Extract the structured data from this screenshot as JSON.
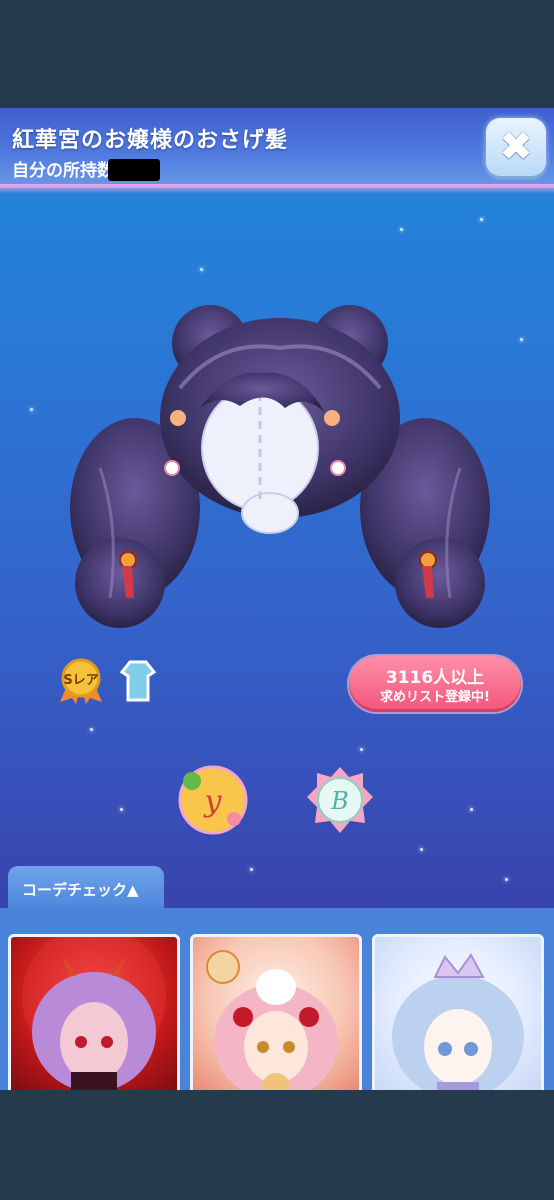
{
  "item": {
    "title": "紅華宮のお嬢様のおさげ髪",
    "owned_label": "自分の所持数",
    "rarity_label": "Sレア",
    "item_type_icon": "dress-icon"
  },
  "wishlist": {
    "count_text": "3116人以上",
    "status_text": "求めリスト登録中!"
  },
  "brands": [
    {
      "name": "brand-y-badge",
      "letter": "y"
    },
    {
      "name": "brand-b-badge",
      "letter": "B"
    }
  ],
  "coordinate": {
    "tab_label": "コーデチェック▲"
  },
  "controls": {
    "close_symbol": "✖"
  },
  "colors": {
    "accent_pink": "#f2557c",
    "panel_blue": "#4a83da",
    "header_blue": "#4f79de"
  }
}
